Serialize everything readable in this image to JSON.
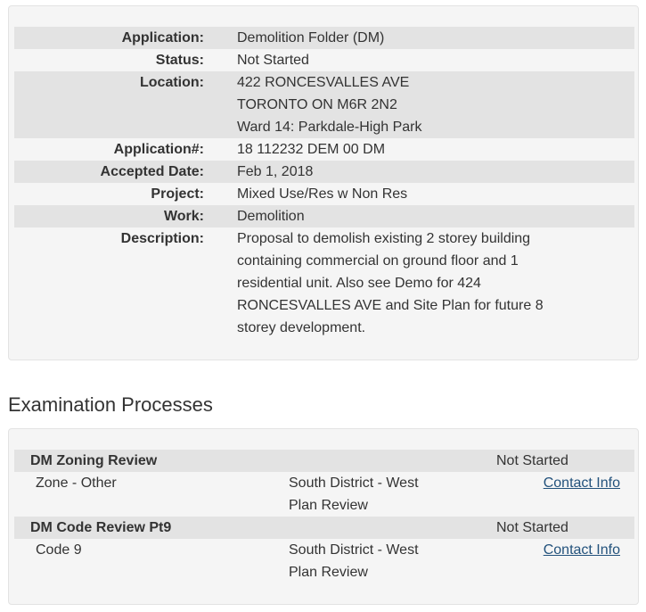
{
  "info": {
    "application": {
      "label": "Application:",
      "value": "Demolition Folder (DM)"
    },
    "status": {
      "label": "Status:",
      "value": "Not Started"
    },
    "location": {
      "label": "Location:",
      "lines": [
        "422 RONCESVALLES AVE",
        "TORONTO ON M6R 2N2",
        "Ward 14: Parkdale-High Park"
      ]
    },
    "application_number": {
      "label": "Application#:",
      "value": "18 112232 DEM 00 DM"
    },
    "accepted_date": {
      "label": "Accepted Date:",
      "value": "Feb 1, 2018"
    },
    "project": {
      "label": "Project:",
      "value": "Mixed Use/Res w Non Res"
    },
    "work": {
      "label": "Work:",
      "value": "Demolition"
    },
    "description": {
      "label": "Description:",
      "lines": [
        "Proposal to demolish existing 2 storey building",
        "containing commercial on ground floor and 1",
        "residential unit. Also see Demo for 424",
        "RONCESVALLES AVE and Site Plan for future 8",
        "storey development."
      ]
    }
  },
  "examination": {
    "title": "Examination Processes",
    "processes": [
      {
        "name": "DM Zoning Review",
        "status": "Not Started",
        "type": "Zone - Other",
        "district_lines": [
          "South District - West",
          "Plan Review"
        ],
        "contact": "Contact Info"
      },
      {
        "name": "DM Code Review Pt9",
        "status": "Not Started",
        "type": "Code 9",
        "district_lines": [
          "South District - West",
          "Plan Review"
        ],
        "contact": "Contact Info"
      }
    ]
  }
}
